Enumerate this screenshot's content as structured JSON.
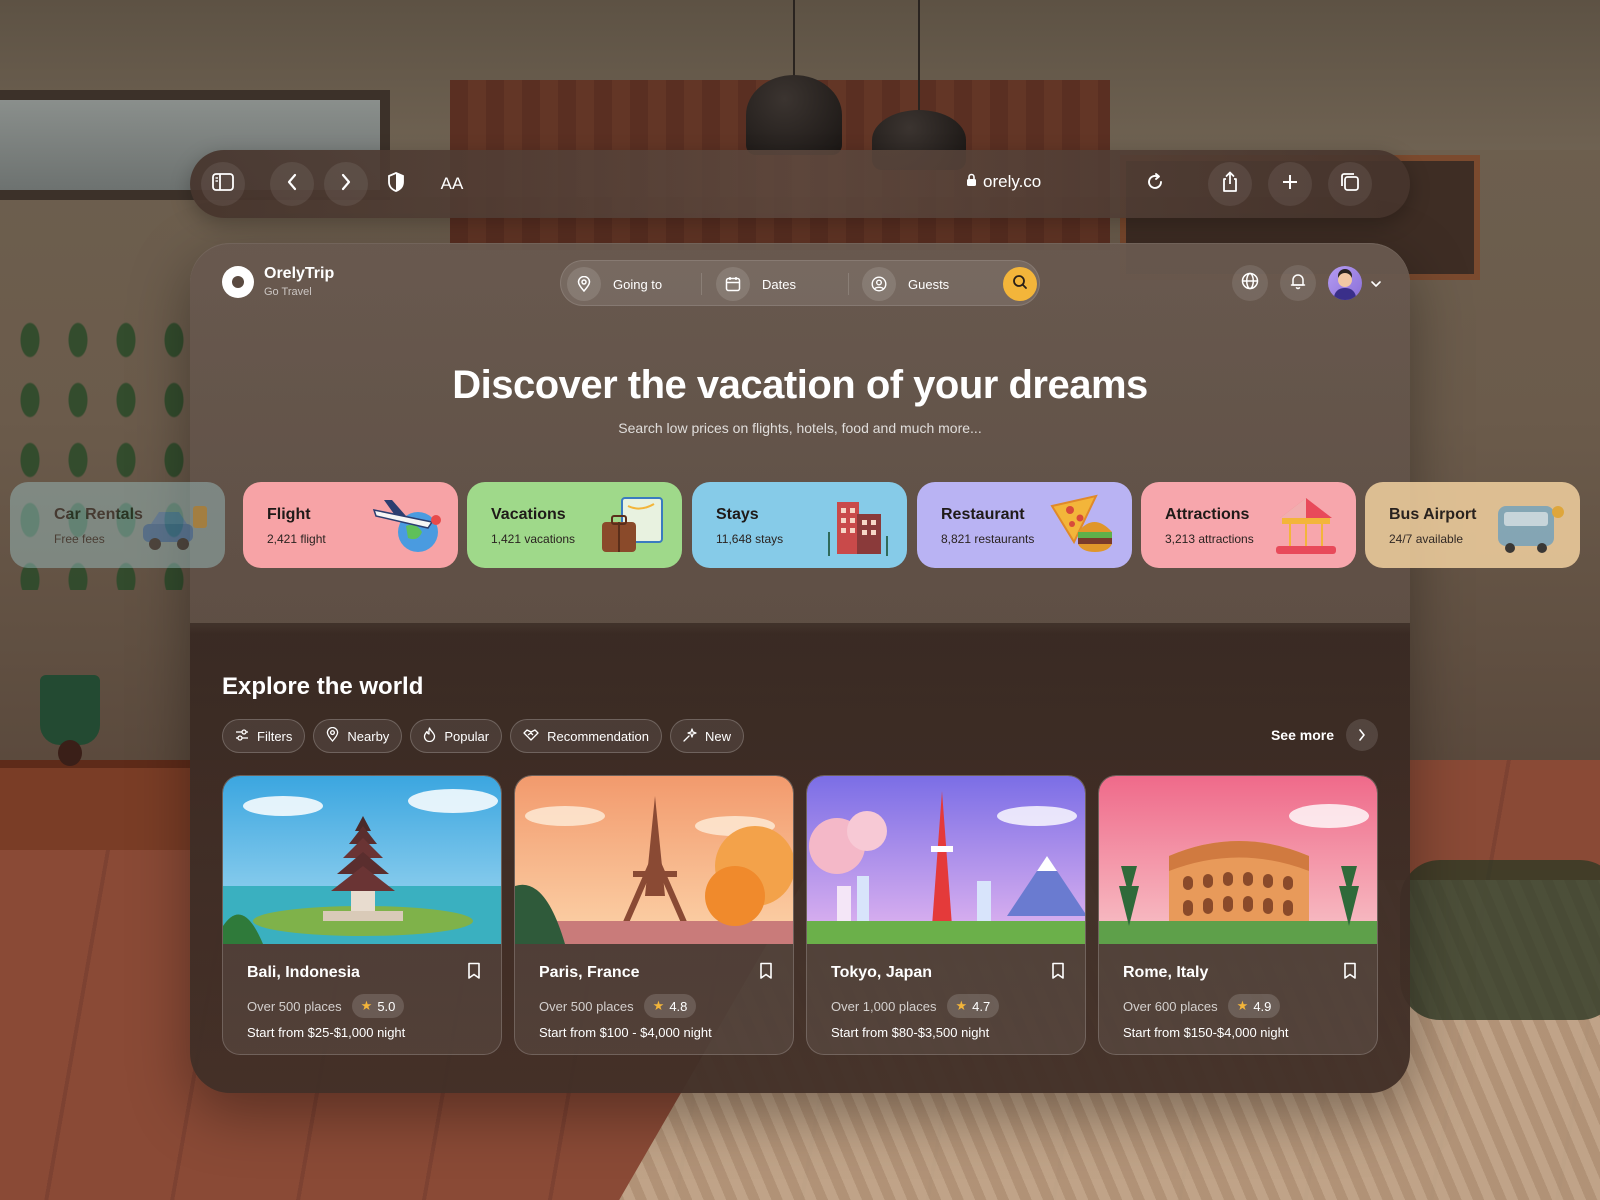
{
  "browser": {
    "url": "orely.co",
    "text_size_label": "AA"
  },
  "brand": {
    "name": "OrelyTrip",
    "tagline": "Go Travel"
  },
  "search": {
    "going_to": "Going to",
    "dates": "Dates",
    "guests": "Guests"
  },
  "hero": {
    "title": "Discover the vacation of your dreams",
    "subtitle": "Search low prices on flights, hotels, food and much more..."
  },
  "categories": [
    {
      "title": "Car Rentals",
      "sub": "Free fees",
      "color": "#9ec6c9"
    },
    {
      "title": "Flight",
      "sub": "2,421 flight",
      "color": "#f7a3a6"
    },
    {
      "title": "Vacations",
      "sub": "1,421 vacations",
      "color": "#9fd98a"
    },
    {
      "title": "Stays",
      "sub": "11,648 stays",
      "color": "#86cbe8"
    },
    {
      "title": "Restaurant",
      "sub": "8,821 restaurants",
      "color": "#b9b3f3"
    },
    {
      "title": "Attractions",
      "sub": "3,213 attractions",
      "color": "#f7a6ac"
    },
    {
      "title": "Bus Airport",
      "sub": "24/7 available",
      "color": "#f2d1a0"
    }
  ],
  "explore": {
    "title": "Explore the world",
    "see_more": "See more",
    "filters": [
      "Filters",
      "Nearby",
      "Popular",
      "Recommendation",
      "New"
    ]
  },
  "destinations": [
    {
      "name": "Bali, Indonesia",
      "places": "Over 500 places",
      "rating": "5.0",
      "price": "Start from $25-$1,000 night"
    },
    {
      "name": "Paris, France",
      "places": "Over 500 places",
      "rating": "4.8",
      "price": "Start from $100 - $4,000 night"
    },
    {
      "name": "Tokyo, Japan",
      "places": "Over 1,000 places",
      "rating": "4.7",
      "price": "Start from $80-$3,500 night"
    },
    {
      "name": "Rome, Italy",
      "places": "Over 600 places",
      "rating": "4.9",
      "price": "Start from $150-$4,000 night"
    }
  ],
  "colors": {
    "accent": "#f3b53a",
    "star": "#f3b53a"
  }
}
